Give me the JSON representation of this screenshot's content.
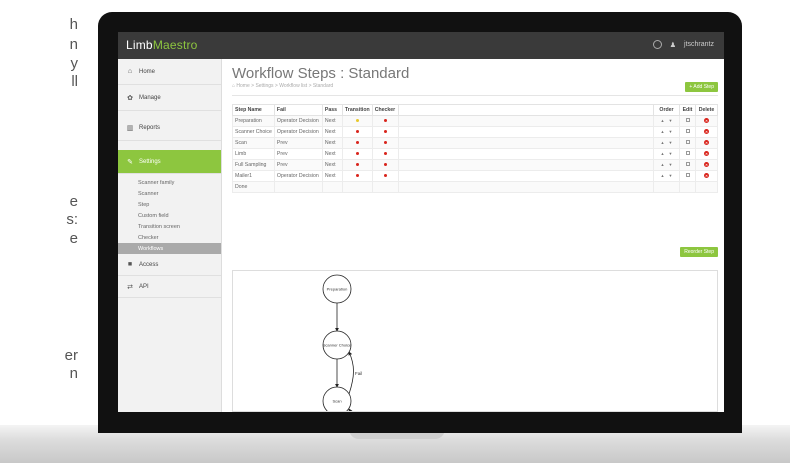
{
  "cut_text": [
    "h",
    "n",
    "y",
    "ll",
    "e",
    "s:",
    "e",
    "er",
    "n"
  ],
  "app": {
    "logo_main": "Limb",
    "logo_accent": "Maestro",
    "user": "jtschrantz"
  },
  "sidebar": {
    "items": [
      {
        "icon": "home-icon",
        "glyph": "⌂",
        "label": "Home"
      },
      {
        "icon": "gear-icon",
        "glyph": "✿",
        "label": "Manage"
      },
      {
        "icon": "bar-chart-icon",
        "glyph": "▥",
        "label": "Reports"
      },
      {
        "icon": "wrench-icon",
        "glyph": "✎",
        "label": "Settings"
      }
    ],
    "sub_items": [
      "Scanner family",
      "Scanner",
      "Step",
      "Custom field",
      "Transition screen",
      "Checker",
      "Workflows"
    ],
    "bottom_items": [
      {
        "icon": "lock-icon",
        "glyph": "■",
        "label": "Access"
      },
      {
        "icon": "shuffle-icon",
        "glyph": "⇄",
        "label": "API"
      }
    ]
  },
  "main": {
    "title": "Workflow Steps : Standard",
    "breadcrumb": "⌂ Home  >  Settings  >  Workflow list  >  Standard",
    "add_step": "+ Add Step",
    "reorder_step": "Reorder Step"
  },
  "table": {
    "headers": [
      "Step Name",
      "Fail",
      "Pass",
      "Transition",
      "Checker",
      "",
      "Order",
      "Edit",
      "Delete"
    ],
    "rows": [
      {
        "name": "Preparation",
        "fail": "Operator Decision",
        "pass": "Next",
        "transition": "yellow",
        "checker": "red"
      },
      {
        "name": "Scanner Choice",
        "fail": "Operator Decision",
        "pass": "Next",
        "transition": "red",
        "checker": "red"
      },
      {
        "name": "Scan",
        "fail": "Prev",
        "pass": "Next",
        "transition": "red",
        "checker": "red"
      },
      {
        "name": "Limb",
        "fail": "Prev",
        "pass": "Next",
        "transition": "red",
        "checker": "red"
      },
      {
        "name": "Full Sampling",
        "fail": "Prev",
        "pass": "Next",
        "transition": "red",
        "checker": "red"
      },
      {
        "name": "Mailer1",
        "fail": "Operator Decision",
        "pass": "Next",
        "transition": "red",
        "checker": "red"
      },
      {
        "name": "Done",
        "fail": "",
        "pass": "",
        "transition": "",
        "checker": ""
      }
    ]
  },
  "diagram": {
    "nodes": [
      "Preparation",
      "Scanner Choice",
      "Scan"
    ],
    "edge_labels": [
      "Fail",
      "Fail"
    ]
  },
  "colors": {
    "accent": "#8dc63f",
    "topbar": "#3a3a3a",
    "dot_red": "#d9241c",
    "dot_yellow": "#e8c82a"
  }
}
